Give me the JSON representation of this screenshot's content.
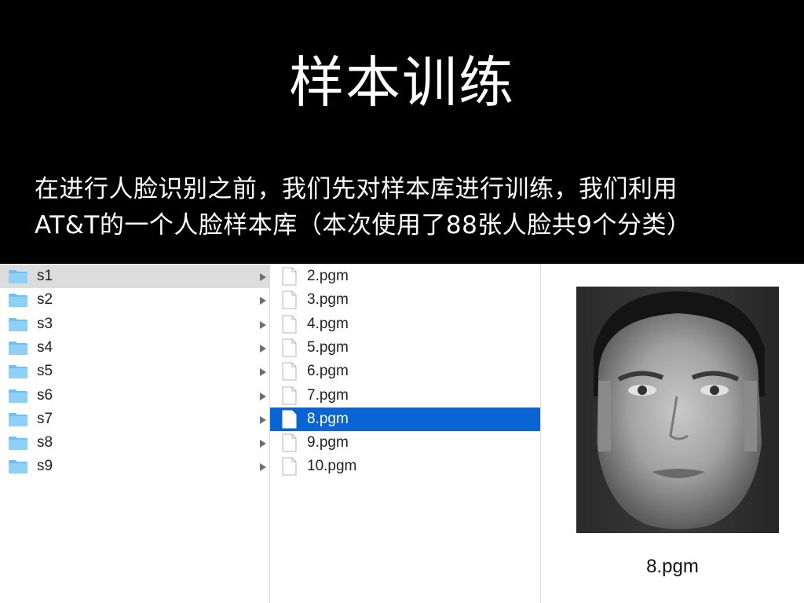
{
  "slide": {
    "title": "样本训练",
    "body_line1": "在进行人脸识别之前，我们先对样本库进行训练，我们利用",
    "body_line2": "AT&T的一个人脸样本库（本次使用了88张人脸共9个分类）"
  },
  "finder": {
    "folders": [
      {
        "label": "s1",
        "selected": true
      },
      {
        "label": "s2"
      },
      {
        "label": "s3"
      },
      {
        "label": "s4"
      },
      {
        "label": "s5"
      },
      {
        "label": "s6"
      },
      {
        "label": "s7"
      },
      {
        "label": "s8"
      },
      {
        "label": "s9"
      }
    ],
    "files": [
      {
        "label": "2.pgm"
      },
      {
        "label": "3.pgm"
      },
      {
        "label": "4.pgm"
      },
      {
        "label": "5.pgm"
      },
      {
        "label": "6.pgm"
      },
      {
        "label": "7.pgm"
      },
      {
        "label": "8.pgm",
        "selected": true
      },
      {
        "label": "9.pgm"
      },
      {
        "label": "10.pgm"
      }
    ],
    "preview": {
      "filename": "8.pgm",
      "image": "grayscale-face-photo"
    }
  },
  "colors": {
    "folder_icon": "#6ec0f3",
    "selection_blue": "#0a64d6",
    "selection_gray": "#dcdcdc"
  }
}
